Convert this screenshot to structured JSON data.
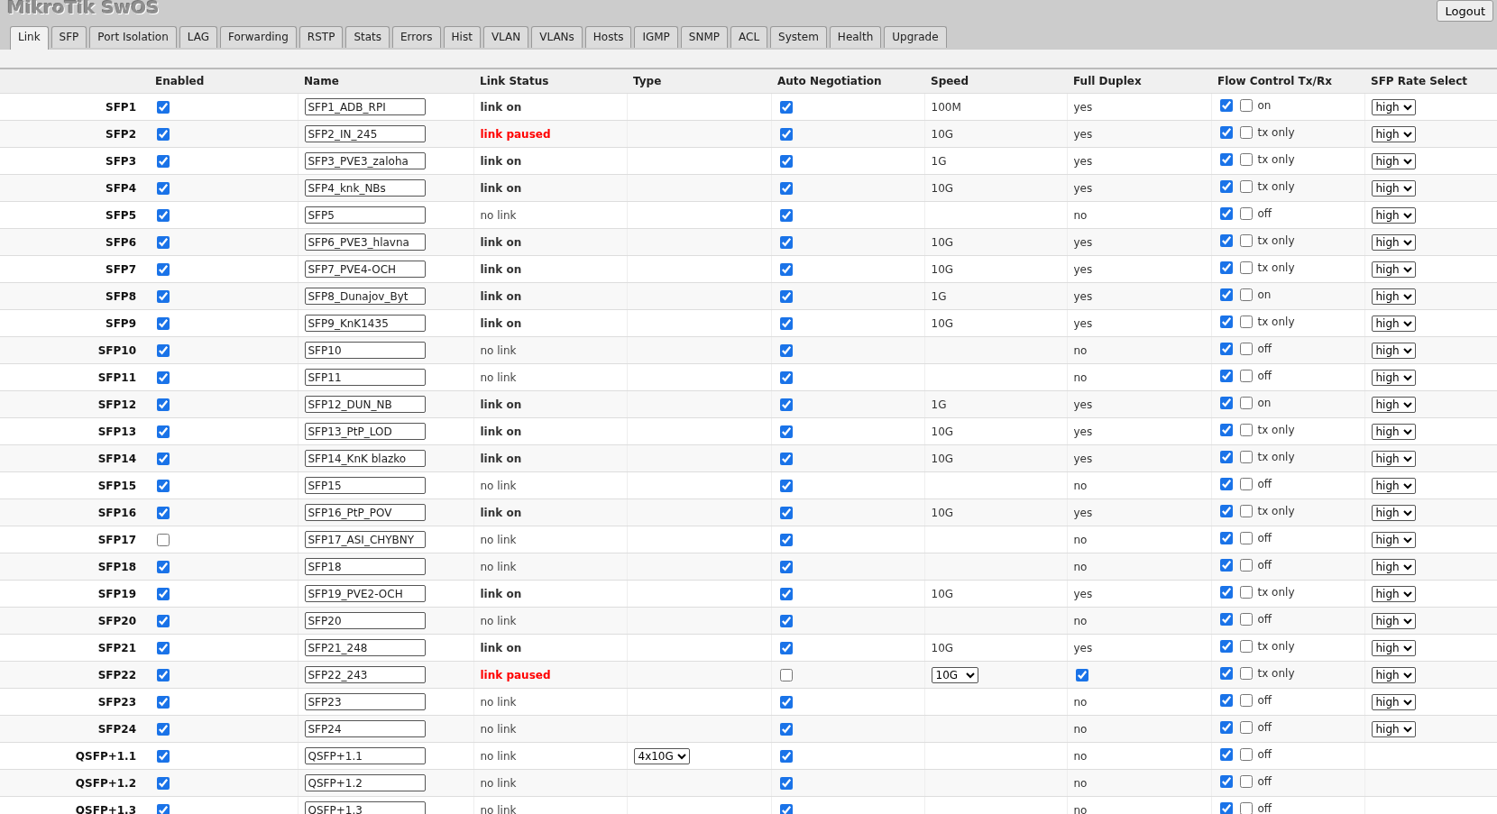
{
  "header": {
    "title": "MikroTik SwOS",
    "logout": "Logout"
  },
  "tabs": [
    {
      "label": "Link",
      "selected": true
    },
    {
      "label": "SFP",
      "selected": false
    },
    {
      "label": "Port Isolation",
      "selected": false
    },
    {
      "label": "LAG",
      "selected": false
    },
    {
      "label": "Forwarding",
      "selected": false
    },
    {
      "label": "RSTP",
      "selected": false
    },
    {
      "label": "Stats",
      "selected": false
    },
    {
      "label": "Errors",
      "selected": false
    },
    {
      "label": "Hist",
      "selected": false
    },
    {
      "label": "VLAN",
      "selected": false
    },
    {
      "label": "VLANs",
      "selected": false
    },
    {
      "label": "Hosts",
      "selected": false
    },
    {
      "label": "IGMP",
      "selected": false
    },
    {
      "label": "SNMP",
      "selected": false
    },
    {
      "label": "ACL",
      "selected": false
    },
    {
      "label": "System",
      "selected": false
    },
    {
      "label": "Health",
      "selected": false
    },
    {
      "label": "Upgrade",
      "selected": false
    }
  ],
  "table": {
    "columns": [
      "Enabled",
      "Name",
      "Link Status",
      "Type",
      "Auto Negotiation",
      "Speed",
      "Full Duplex",
      "Flow Control Tx/Rx",
      "SFP Rate Select"
    ],
    "rows": [
      {
        "port": "SFP1",
        "enabled": true,
        "name": "SFP1_ADB_RPI",
        "status": {
          "kind": "up",
          "text": "link on"
        },
        "auto_negotiation": true,
        "speed": {
          "kind": "text",
          "value": "100M"
        },
        "full_duplex": {
          "kind": "text",
          "value": "yes"
        },
        "flow_tx": true,
        "flow_rx": false,
        "flow_text": "on",
        "rate": "high"
      },
      {
        "port": "SFP2",
        "enabled": true,
        "name": "SFP2_IN_245",
        "status": {
          "kind": "paused",
          "text": "link paused"
        },
        "auto_negotiation": true,
        "speed": {
          "kind": "text",
          "value": "10G"
        },
        "full_duplex": {
          "kind": "text",
          "value": "yes"
        },
        "flow_tx": true,
        "flow_rx": false,
        "flow_text": "tx only",
        "rate": "high"
      },
      {
        "port": "SFP3",
        "enabled": true,
        "name": "SFP3_PVE3_zaloha",
        "status": {
          "kind": "up",
          "text": "link on"
        },
        "auto_negotiation": true,
        "speed": {
          "kind": "text",
          "value": "1G"
        },
        "full_duplex": {
          "kind": "text",
          "value": "yes"
        },
        "flow_tx": true,
        "flow_rx": false,
        "flow_text": "tx only",
        "rate": "high"
      },
      {
        "port": "SFP4",
        "enabled": true,
        "name": "SFP4_knk_NBs",
        "status": {
          "kind": "up",
          "text": "link on"
        },
        "auto_negotiation": true,
        "speed": {
          "kind": "text",
          "value": "10G"
        },
        "full_duplex": {
          "kind": "text",
          "value": "yes"
        },
        "flow_tx": true,
        "flow_rx": false,
        "flow_text": "tx only",
        "rate": "high"
      },
      {
        "port": "SFP5",
        "enabled": true,
        "name": "SFP5",
        "status": {
          "kind": "down",
          "text": "no link"
        },
        "auto_negotiation": true,
        "full_duplex": {
          "kind": "text",
          "value": "no"
        },
        "flow_tx": true,
        "flow_rx": false,
        "flow_text": "off",
        "rate": "high"
      },
      {
        "port": "SFP6",
        "enabled": true,
        "name": "SFP6_PVE3_hlavna",
        "status": {
          "kind": "up",
          "text": "link on"
        },
        "auto_negotiation": true,
        "speed": {
          "kind": "text",
          "value": "10G"
        },
        "full_duplex": {
          "kind": "text",
          "value": "yes"
        },
        "flow_tx": true,
        "flow_rx": false,
        "flow_text": "tx only",
        "rate": "high"
      },
      {
        "port": "SFP7",
        "enabled": true,
        "name": "SFP7_PVE4-OCH",
        "status": {
          "kind": "up",
          "text": "link on"
        },
        "auto_negotiation": true,
        "speed": {
          "kind": "text",
          "value": "10G"
        },
        "full_duplex": {
          "kind": "text",
          "value": "yes"
        },
        "flow_tx": true,
        "flow_rx": false,
        "flow_text": "tx only",
        "rate": "high"
      },
      {
        "port": "SFP8",
        "enabled": true,
        "name": "SFP8_Dunajov_Byt",
        "status": {
          "kind": "up",
          "text": "link on"
        },
        "auto_negotiation": true,
        "speed": {
          "kind": "text",
          "value": "1G"
        },
        "full_duplex": {
          "kind": "text",
          "value": "yes"
        },
        "flow_tx": true,
        "flow_rx": false,
        "flow_text": "on",
        "rate": "high"
      },
      {
        "port": "SFP9",
        "enabled": true,
        "name": "SFP9_KnK1435",
        "status": {
          "kind": "up",
          "text": "link on"
        },
        "auto_negotiation": true,
        "speed": {
          "kind": "text",
          "value": "10G"
        },
        "full_duplex": {
          "kind": "text",
          "value": "yes"
        },
        "flow_tx": true,
        "flow_rx": false,
        "flow_text": "tx only",
        "rate": "high"
      },
      {
        "port": "SFP10",
        "enabled": true,
        "name": "SFP10",
        "status": {
          "kind": "down",
          "text": "no link"
        },
        "auto_negotiation": true,
        "full_duplex": {
          "kind": "text",
          "value": "no"
        },
        "flow_tx": true,
        "flow_rx": false,
        "flow_text": "off",
        "rate": "high"
      },
      {
        "port": "SFP11",
        "enabled": true,
        "name": "SFP11",
        "status": {
          "kind": "down",
          "text": "no link"
        },
        "auto_negotiation": true,
        "full_duplex": {
          "kind": "text",
          "value": "no"
        },
        "flow_tx": true,
        "flow_rx": false,
        "flow_text": "off",
        "rate": "high"
      },
      {
        "port": "SFP12",
        "enabled": true,
        "name": "SFP12_DUN_NB",
        "status": {
          "kind": "up",
          "text": "link on"
        },
        "auto_negotiation": true,
        "speed": {
          "kind": "text",
          "value": "1G"
        },
        "full_duplex": {
          "kind": "text",
          "value": "yes"
        },
        "flow_tx": true,
        "flow_rx": false,
        "flow_text": "on",
        "rate": "high"
      },
      {
        "port": "SFP13",
        "enabled": true,
        "name": "SFP13_PtP_LOD",
        "status": {
          "kind": "up",
          "text": "link on"
        },
        "auto_negotiation": true,
        "speed": {
          "kind": "text",
          "value": "10G"
        },
        "full_duplex": {
          "kind": "text",
          "value": "yes"
        },
        "flow_tx": true,
        "flow_rx": false,
        "flow_text": "tx only",
        "rate": "high"
      },
      {
        "port": "SFP14",
        "enabled": true,
        "name": "SFP14_KnK blazko",
        "status": {
          "kind": "up",
          "text": "link on"
        },
        "auto_negotiation": true,
        "speed": {
          "kind": "text",
          "value": "10G"
        },
        "full_duplex": {
          "kind": "text",
          "value": "yes"
        },
        "flow_tx": true,
        "flow_rx": false,
        "flow_text": "tx only",
        "rate": "high"
      },
      {
        "port": "SFP15",
        "enabled": true,
        "name": "SFP15",
        "status": {
          "kind": "down",
          "text": "no link"
        },
        "auto_negotiation": true,
        "full_duplex": {
          "kind": "text",
          "value": "no"
        },
        "flow_tx": true,
        "flow_rx": false,
        "flow_text": "off",
        "rate": "high"
      },
      {
        "port": "SFP16",
        "enabled": true,
        "name": "SFP16_PtP_POV",
        "status": {
          "kind": "up",
          "text": "link on"
        },
        "auto_negotiation": true,
        "speed": {
          "kind": "text",
          "value": "10G"
        },
        "full_duplex": {
          "kind": "text",
          "value": "yes"
        },
        "flow_tx": true,
        "flow_rx": false,
        "flow_text": "tx only",
        "rate": "high"
      },
      {
        "port": "SFP17",
        "enabled": false,
        "name": "SFP17_ASI_CHYBNY",
        "status": {
          "kind": "down",
          "text": "no link"
        },
        "auto_negotiation": true,
        "full_duplex": {
          "kind": "text",
          "value": "no"
        },
        "flow_tx": true,
        "flow_rx": false,
        "flow_text": "off",
        "rate": "high"
      },
      {
        "port": "SFP18",
        "enabled": true,
        "name": "SFP18",
        "status": {
          "kind": "down",
          "text": "no link"
        },
        "auto_negotiation": true,
        "full_duplex": {
          "kind": "text",
          "value": "no"
        },
        "flow_tx": true,
        "flow_rx": false,
        "flow_text": "off",
        "rate": "high"
      },
      {
        "port": "SFP19",
        "enabled": true,
        "name": "SFP19_PVE2-OCH",
        "status": {
          "kind": "up",
          "text": "link on"
        },
        "auto_negotiation": true,
        "speed": {
          "kind": "text",
          "value": "10G"
        },
        "full_duplex": {
          "kind": "text",
          "value": "yes"
        },
        "flow_tx": true,
        "flow_rx": false,
        "flow_text": "tx only",
        "rate": "high"
      },
      {
        "port": "SFP20",
        "enabled": true,
        "name": "SFP20",
        "status": {
          "kind": "down",
          "text": "no link"
        },
        "auto_negotiation": true,
        "full_duplex": {
          "kind": "text",
          "value": "no"
        },
        "flow_tx": true,
        "flow_rx": false,
        "flow_text": "off",
        "rate": "high"
      },
      {
        "port": "SFP21",
        "enabled": true,
        "name": "SFP21_248",
        "status": {
          "kind": "up",
          "text": "link on"
        },
        "auto_negotiation": true,
        "speed": {
          "kind": "text",
          "value": "10G"
        },
        "full_duplex": {
          "kind": "text",
          "value": "yes"
        },
        "flow_tx": true,
        "flow_rx": false,
        "flow_text": "tx only",
        "rate": "high"
      },
      {
        "port": "SFP22",
        "enabled": true,
        "name": "SFP22_243",
        "status": {
          "kind": "paused",
          "text": "link paused"
        },
        "auto_negotiation": false,
        "speed": {
          "kind": "select",
          "value": "10G"
        },
        "full_duplex": {
          "kind": "checkbox",
          "checked": true
        },
        "flow_tx": true,
        "flow_rx": false,
        "flow_text": "tx only",
        "rate": "high"
      },
      {
        "port": "SFP23",
        "enabled": true,
        "name": "SFP23",
        "status": {
          "kind": "down",
          "text": "no link"
        },
        "auto_negotiation": true,
        "full_duplex": {
          "kind": "text",
          "value": "no"
        },
        "flow_tx": true,
        "flow_rx": false,
        "flow_text": "off",
        "rate": "high"
      },
      {
        "port": "SFP24",
        "enabled": true,
        "name": "SFP24",
        "status": {
          "kind": "down",
          "text": "no link"
        },
        "auto_negotiation": true,
        "full_duplex": {
          "kind": "text",
          "value": "no"
        },
        "flow_tx": true,
        "flow_rx": false,
        "flow_text": "off",
        "rate": "high"
      },
      {
        "port": "QSFP+1.1",
        "enabled": true,
        "name": "QSFP+1.1",
        "status": {
          "kind": "down",
          "text": "no link"
        },
        "type": "4x10G",
        "auto_negotiation": true,
        "full_duplex": {
          "kind": "text",
          "value": "no"
        },
        "flow_tx": true,
        "flow_rx": false,
        "flow_text": "off"
      },
      {
        "port": "QSFP+1.2",
        "enabled": true,
        "name": "QSFP+1.2",
        "status": {
          "kind": "down",
          "text": "no link"
        },
        "auto_negotiation": true,
        "full_duplex": {
          "kind": "text",
          "value": "no"
        },
        "flow_tx": true,
        "flow_rx": false,
        "flow_text": "off"
      },
      {
        "port": "QSFP+1.3",
        "enabled": true,
        "name": "QSFP+1.3",
        "status": {
          "kind": "down",
          "text": "no link"
        },
        "auto_negotiation": true,
        "full_duplex": {
          "kind": "text",
          "value": "no"
        },
        "flow_tx": true,
        "flow_rx": false,
        "flow_text": "off"
      }
    ]
  }
}
